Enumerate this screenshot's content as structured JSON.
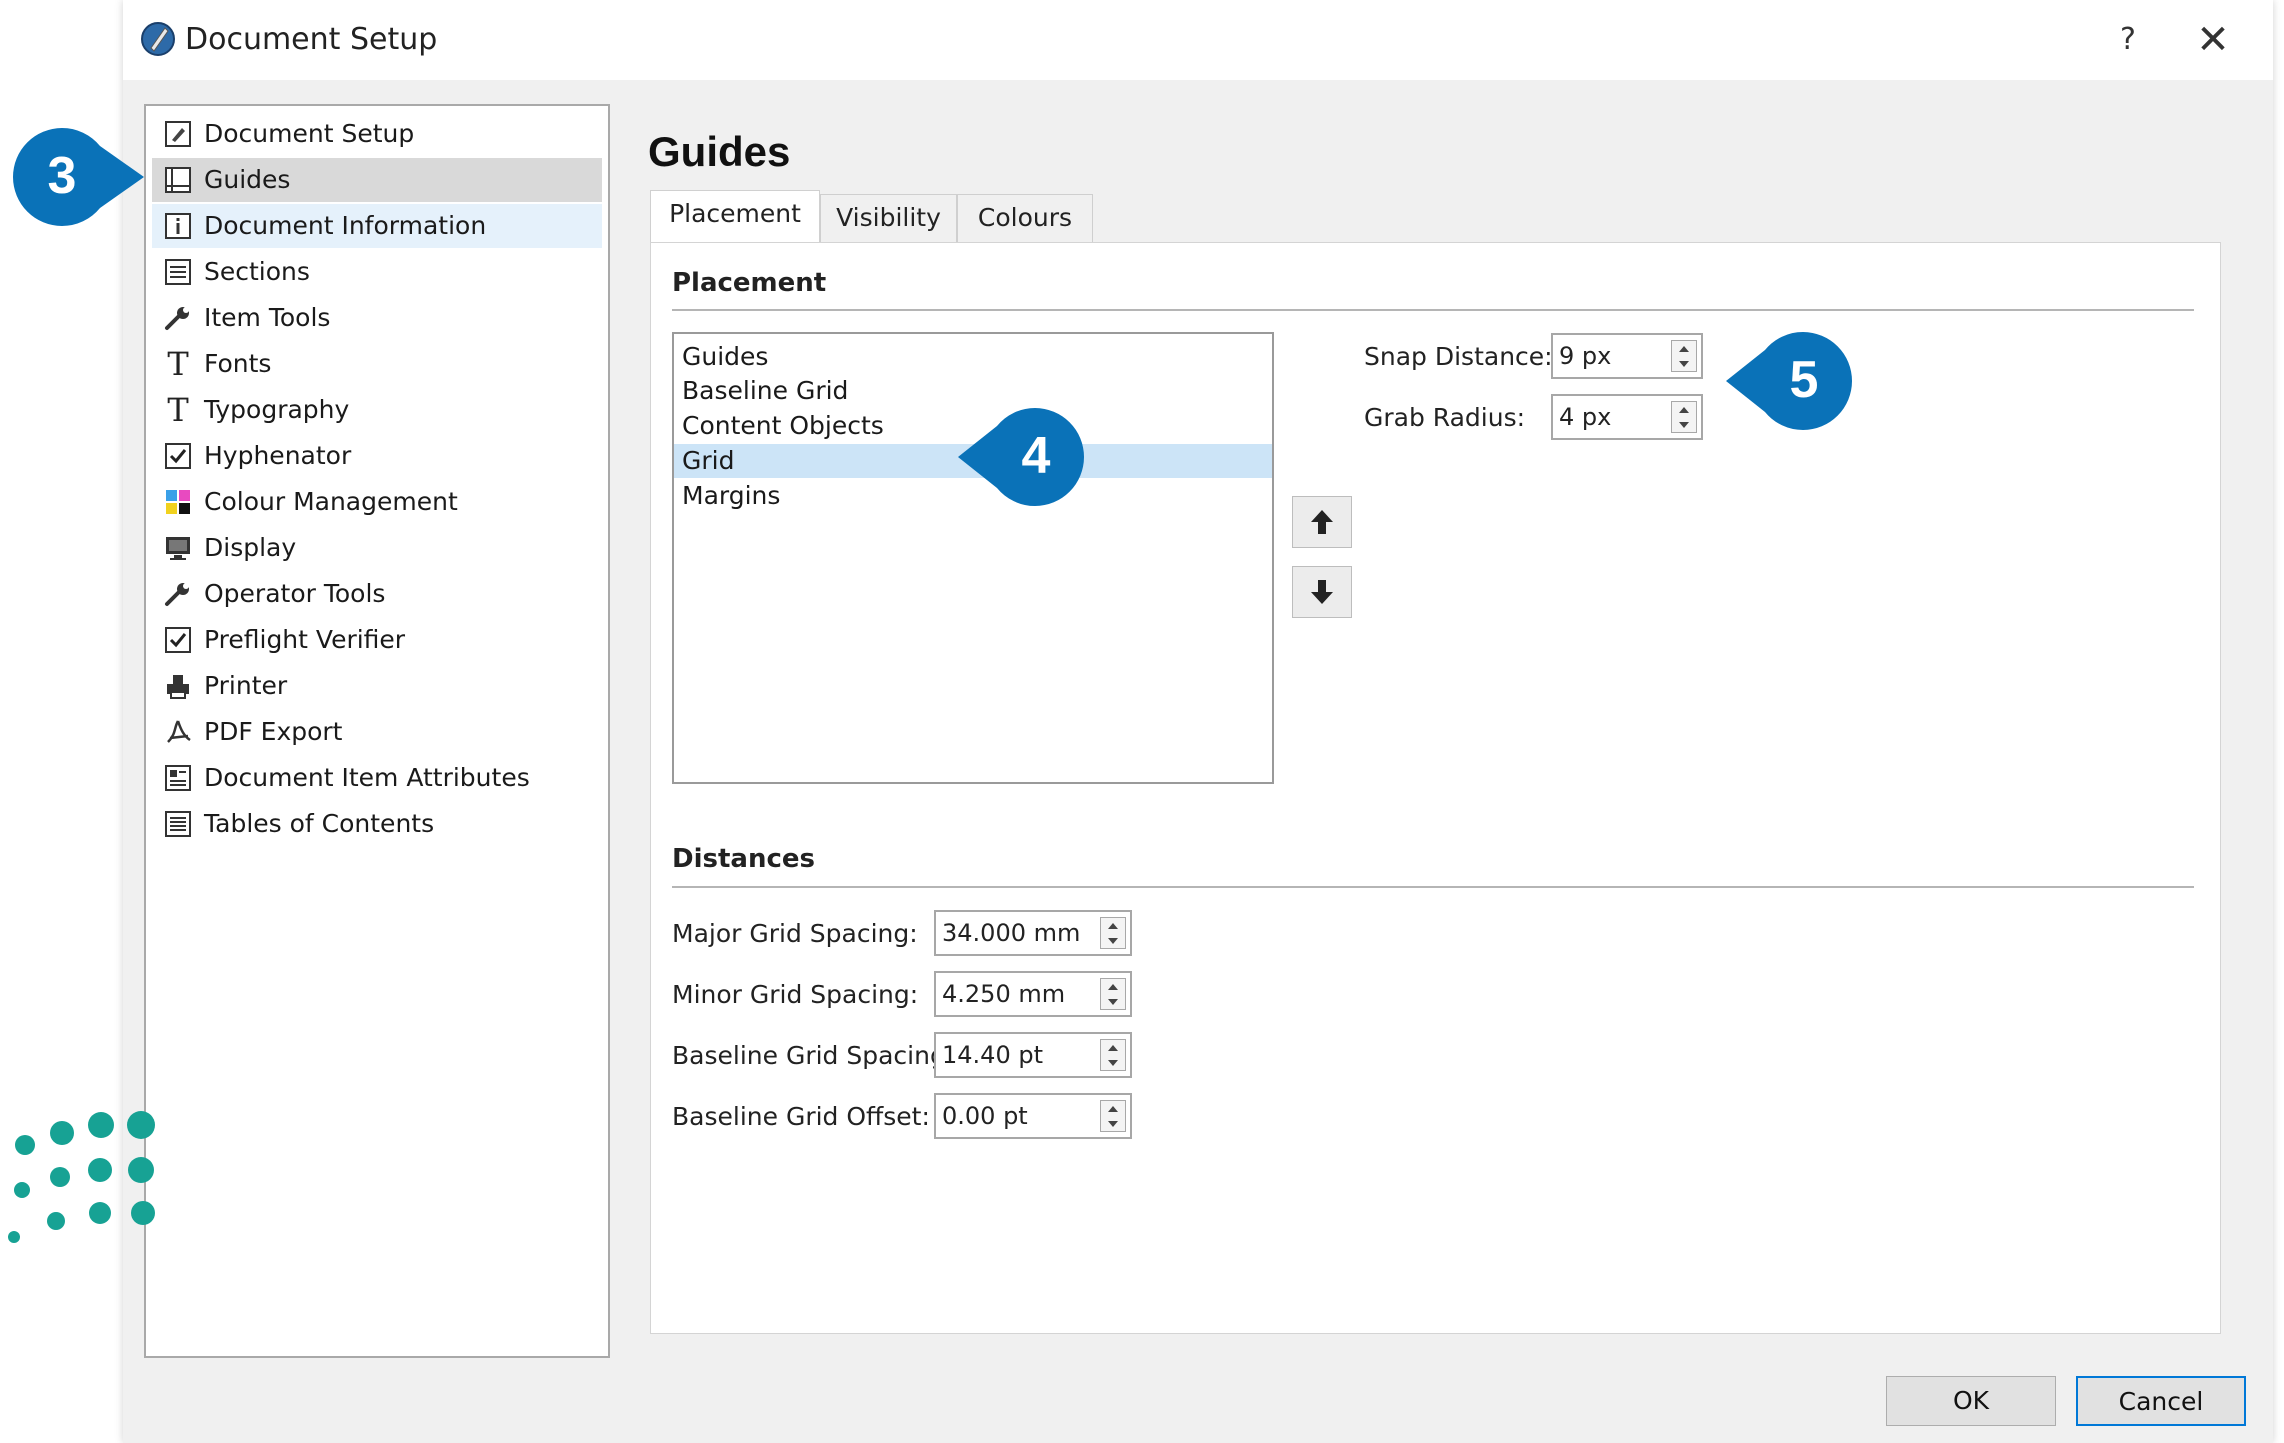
{
  "window": {
    "title": "Document Setup",
    "help_label": "?",
    "close_label": "✕"
  },
  "sidebar": {
    "items": [
      {
        "label": "Document Setup",
        "icon": "document-setup-icon"
      },
      {
        "label": "Guides",
        "icon": "guides-icon",
        "selected": true
      },
      {
        "label": "Document Information",
        "icon": "info-icon",
        "hover": true
      },
      {
        "label": "Sections",
        "icon": "sections-icon"
      },
      {
        "label": "Item Tools",
        "icon": "wrench-icon"
      },
      {
        "label": "Fonts",
        "icon": "font-icon"
      },
      {
        "label": "Typography",
        "icon": "typography-icon"
      },
      {
        "label": "Hyphenator",
        "icon": "checkbox-icon"
      },
      {
        "label": "Colour Management",
        "icon": "color-squares-icon"
      },
      {
        "label": "Display",
        "icon": "monitor-icon"
      },
      {
        "label": "Operator Tools",
        "icon": "wrench-icon"
      },
      {
        "label": "Preflight Verifier",
        "icon": "checkbox-icon"
      },
      {
        "label": "Printer",
        "icon": "printer-icon"
      },
      {
        "label": "PDF Export",
        "icon": "pdf-icon"
      },
      {
        "label": "Document Item Attributes",
        "icon": "attributes-icon"
      },
      {
        "label": "Tables of Contents",
        "icon": "toc-icon"
      }
    ]
  },
  "main": {
    "heading": "Guides",
    "tabs": [
      {
        "label": "Placement",
        "active": true
      },
      {
        "label": "Visibility"
      },
      {
        "label": "Colours"
      }
    ],
    "placement": {
      "section_title": "Placement",
      "list": [
        "Guides",
        "Baseline Grid",
        "Content Objects",
        "Grid",
        "Margins"
      ],
      "selected_index": 3,
      "snap_distance": {
        "label": "Snap Distance:",
        "value": "9 px"
      },
      "grab_radius": {
        "label": "Grab Radius:",
        "value": "4 px"
      }
    },
    "distances": {
      "section_title": "Distances",
      "fields": [
        {
          "label": "Major Grid Spacing:",
          "value": "34.000 mm"
        },
        {
          "label": "Minor Grid Spacing:",
          "value": "4.250 mm"
        },
        {
          "label": "Baseline Grid Spacing:",
          "value": "14.40 pt"
        },
        {
          "label": "Baseline Grid Offset:",
          "value": "0.00 pt"
        }
      ]
    }
  },
  "buttons": {
    "ok": "OK",
    "cancel": "Cancel"
  },
  "callouts": [
    "3",
    "4",
    "5"
  ],
  "colors": {
    "callout_blue": "#0a72b8",
    "selection_blue": "#cce4f7",
    "logo_teal": "#17a294"
  }
}
